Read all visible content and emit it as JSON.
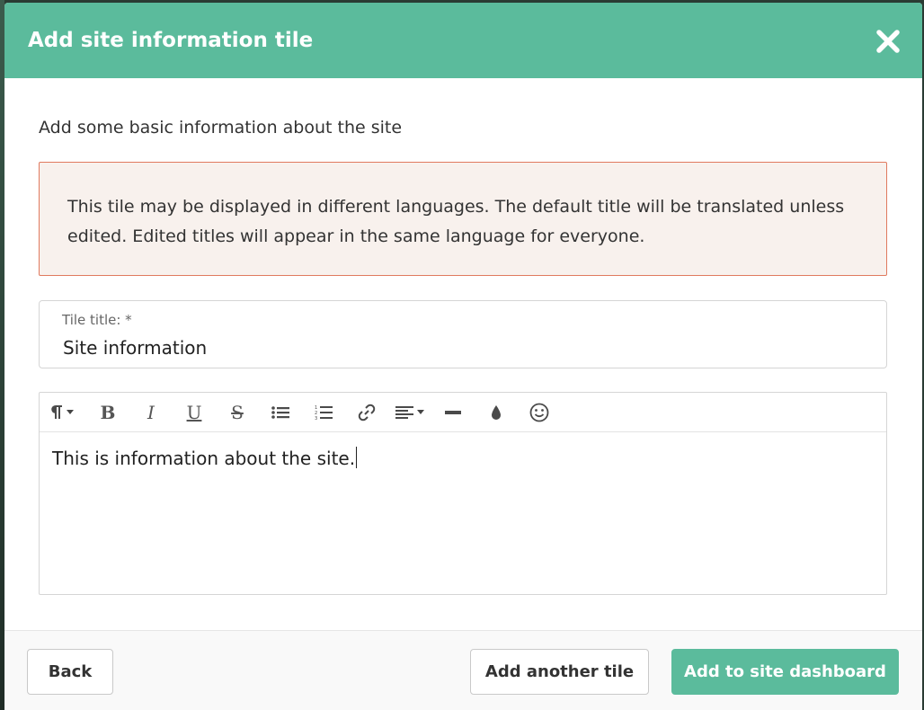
{
  "modal": {
    "title": "Add site information tile",
    "close_icon": "close-icon"
  },
  "body": {
    "intro": "Add some basic information about the site",
    "notice": "This tile may be displayed in different languages. The default title will be translated unless edited. Edited titles will appear in the same language for everyone."
  },
  "tile_title": {
    "label": "Tile title: *",
    "value": "Site information"
  },
  "editor": {
    "toolbar": [
      {
        "name": "paragraph-format-icon",
        "has_dropdown": true
      },
      {
        "name": "bold-icon"
      },
      {
        "name": "italic-icon"
      },
      {
        "name": "underline-icon"
      },
      {
        "name": "strikethrough-icon"
      },
      {
        "name": "bulleted-list-icon"
      },
      {
        "name": "numbered-list-icon"
      },
      {
        "name": "link-icon"
      },
      {
        "name": "align-icon",
        "has_dropdown": true
      },
      {
        "name": "horizontal-rule-icon"
      },
      {
        "name": "text-color-icon"
      },
      {
        "name": "emoji-icon"
      }
    ],
    "content": "This is information about the site."
  },
  "footer": {
    "back_label": "Back",
    "add_another_label": "Add another tile",
    "add_dashboard_label": "Add to site dashboard"
  },
  "colors": {
    "accent": "#5bbb9c",
    "notice_border": "#e07a5f",
    "notice_bg": "#f8f1ed"
  }
}
